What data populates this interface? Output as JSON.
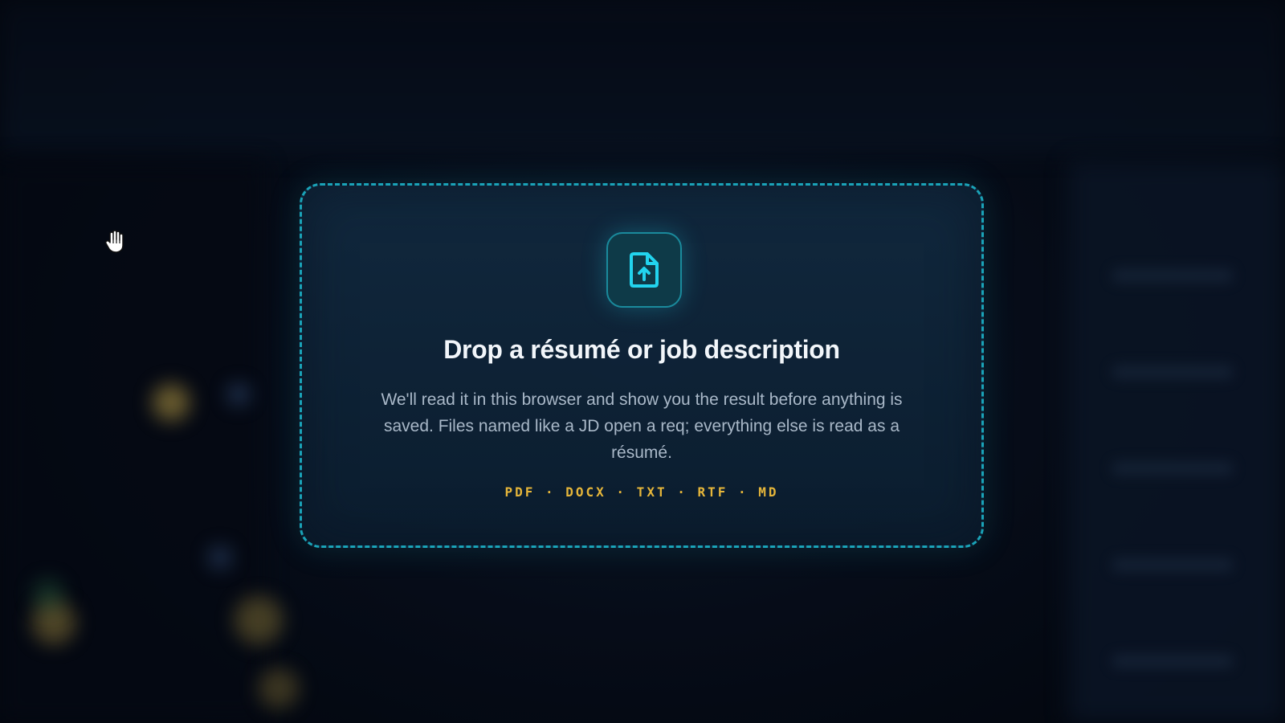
{
  "dropzone": {
    "title": "Drop a résumé or job description",
    "description": "We'll read it in this browser and show you the result before anything is saved. Files named like a JD open a req; everything else is read as a résumé.",
    "formats": "PDF · DOCX · TXT · RTF · MD",
    "icon": "file-upload-icon"
  },
  "cursor": {
    "icon": "grab-hand-cursor-icon"
  },
  "colors": {
    "accent": "#22d3ee",
    "border": "#1aa3b8",
    "format_text": "#e6b63a",
    "background": "#050a14"
  }
}
